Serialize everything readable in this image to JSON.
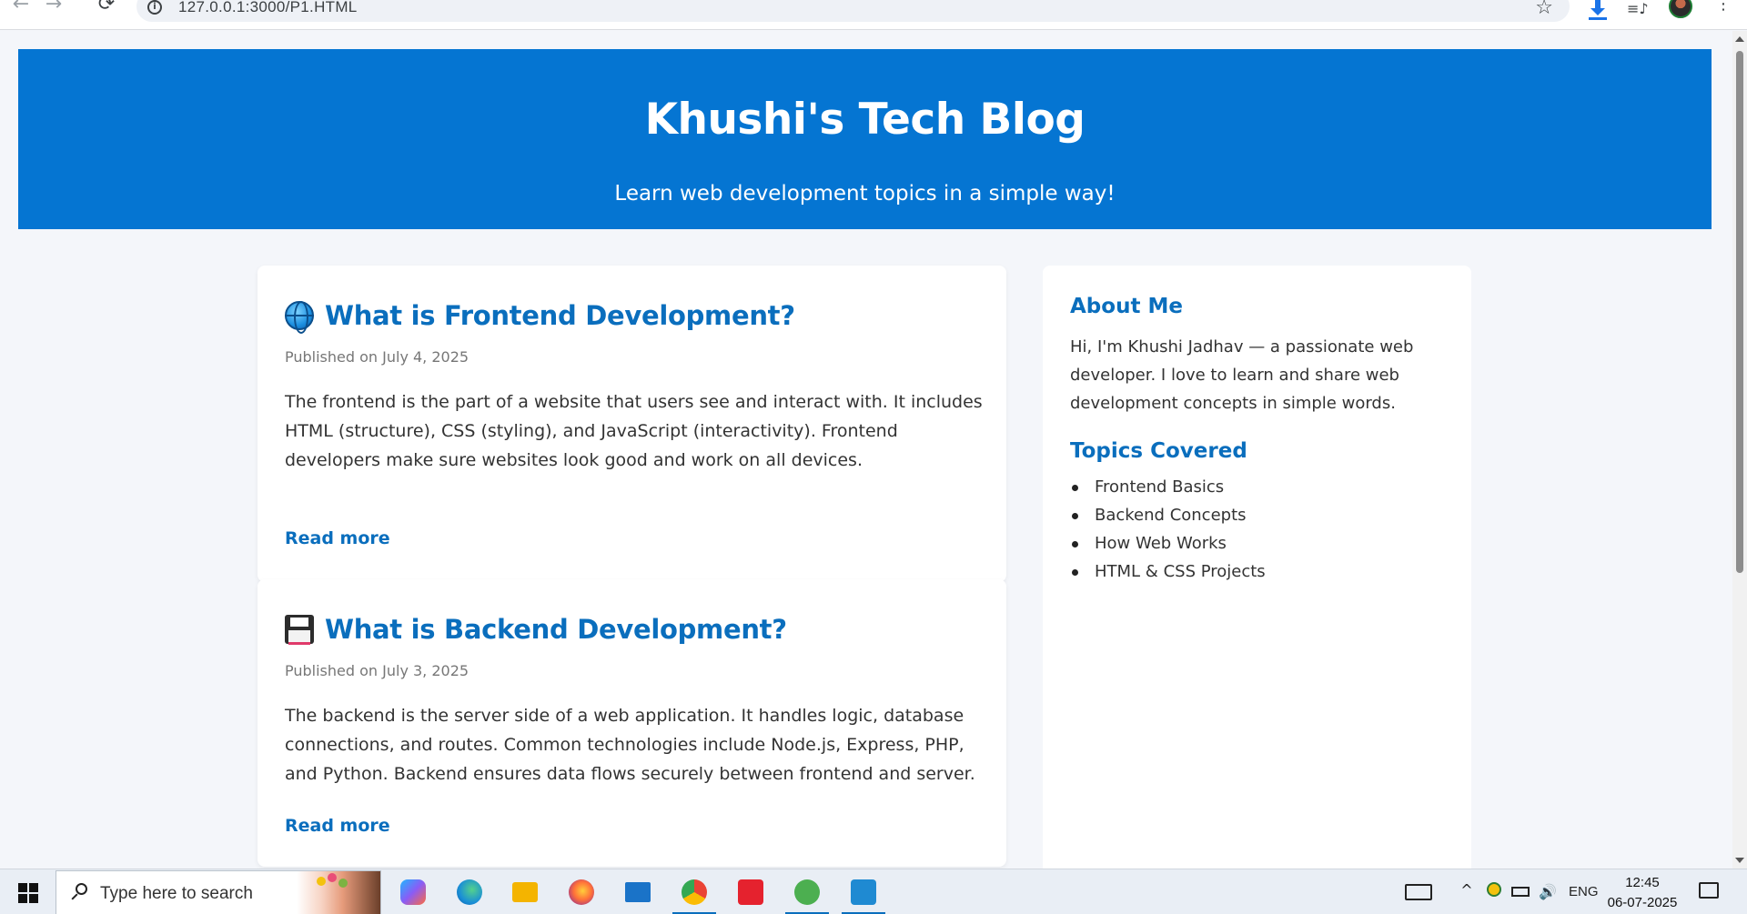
{
  "browser": {
    "url": "127.0.0.1:3000/P1.HTML",
    "back_glyph": "←",
    "forward_glyph": "→",
    "reload_glyph": "⟳",
    "star_glyph": "☆",
    "menu_glyph": "⋮",
    "info_glyph": "i",
    "media_glyph": "≡♪"
  },
  "blog": {
    "title": "Khushi's Tech Blog",
    "tagline": "Learn web development topics in a simple way!",
    "posts": [
      {
        "icon": "globe-icon",
        "title": "What is Frontend Development?",
        "date": "Published on July 4, 2025",
        "body": "The frontend is the part of a website that users see and interact with. It includes HTML (structure), CSS (styling), and JavaScript (interactivity). Frontend developers make sure websites look good and work on all devices.",
        "link": "Read more"
      },
      {
        "icon": "floppy-disk-icon",
        "title": "What is Backend Development?",
        "date": "Published on July 3, 2025",
        "body": "The backend is the server side of a web application. It handles logic, database connections, and routes. Common technologies include Node.js, Express, PHP, and Python. Backend ensures data flows securely between frontend and server.",
        "link": "Read more"
      }
    ]
  },
  "sidebar": {
    "about_title": "About Me",
    "about_text": "Hi, I'm Khushi Jadhav — a passionate web developer. I love to learn and share web development concepts in simple words.",
    "topics_title": "Topics Covered",
    "topics": [
      "Frontend Basics",
      "Backend Concepts",
      "How Web Works",
      "HTML & CSS Projects"
    ]
  },
  "taskbar": {
    "search_placeholder": "Type here to search",
    "apps": [
      "copilot-icon",
      "edge-icon",
      "file-explorer-icon",
      "firefox-icon",
      "mail-icon",
      "chrome-icon",
      "wps-icon",
      "utorrent-icon",
      "vscode-icon"
    ],
    "language": "ENG",
    "time": "12:45",
    "date": "06-07-2025",
    "tray_up_glyph": "^",
    "tray_volume_glyph": "🔊"
  },
  "colors": {
    "header_blue": "#0575d2",
    "link_blue": "#0a6ebd",
    "page_bg": "#f4f6fa"
  }
}
